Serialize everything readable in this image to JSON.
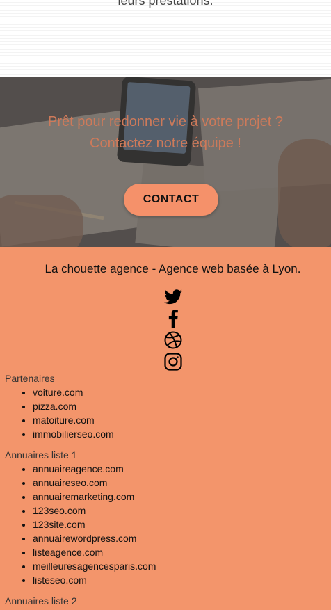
{
  "prev_section": {
    "text": "leurs prestations."
  },
  "hero": {
    "line1": "Prêt pour redonner vie à votre projet ?",
    "line2": "Contactez notre équipe !",
    "button": "CONTACT"
  },
  "footer": {
    "tagline": "La chouette agence - Agence web basée à Lyon.",
    "social_icons": [
      "twitter-icon",
      "facebook-icon",
      "dribbble-icon",
      "instagram-icon"
    ],
    "partners": {
      "title": "Partenaires",
      "items": [
        "voiture.com",
        "pizza.com",
        "matoiture.com",
        "immobilierseo.com"
      ]
    },
    "annuaires1": {
      "title": "Annuaires liste 1",
      "items": [
        "annuaireagence.com",
        "annuaireseo.com",
        "annuairemarketing.com",
        "123seo.com",
        "123site.com",
        "annuairewordpress.com",
        "listeagence.com",
        "meilleuresagencesparis.com",
        "listeseo.com"
      ]
    },
    "annuaires2": {
      "title": "Annuaires liste 2"
    }
  },
  "colors": {
    "footer_bg": "#f3956b",
    "button_bg": "#f5916a",
    "hero_text": "#ce7a5a"
  }
}
